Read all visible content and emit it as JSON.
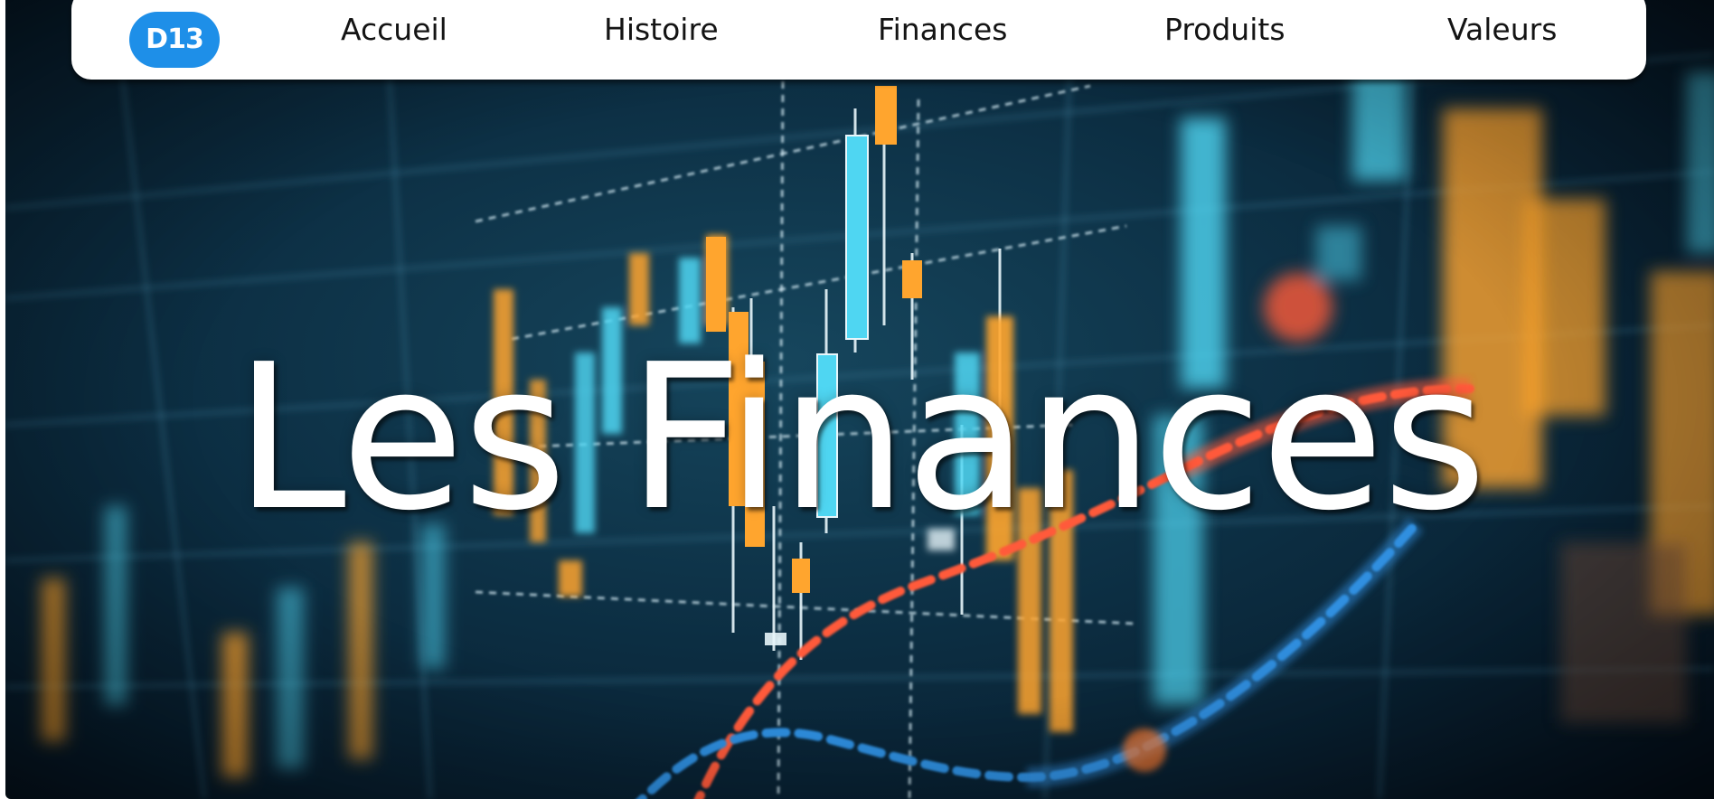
{
  "brand": {
    "logo_text": "D13",
    "logo_color": "#1e8fe8"
  },
  "nav": {
    "items": [
      {
        "label": "Accueil"
      },
      {
        "label": "Histoire"
      },
      {
        "label": "Finances"
      },
      {
        "label": "Produits"
      },
      {
        "label": "Valeurs"
      }
    ]
  },
  "hero": {
    "title": "Les Finances",
    "background": "financial-candlestick-chart-image",
    "palette": {
      "background": "#0d3146",
      "candle_up": "#4fd6f2",
      "candle_down": "#ffa52e",
      "trend_red": "#ff5a3a",
      "trend_blue": "#2f8fe0"
    }
  }
}
